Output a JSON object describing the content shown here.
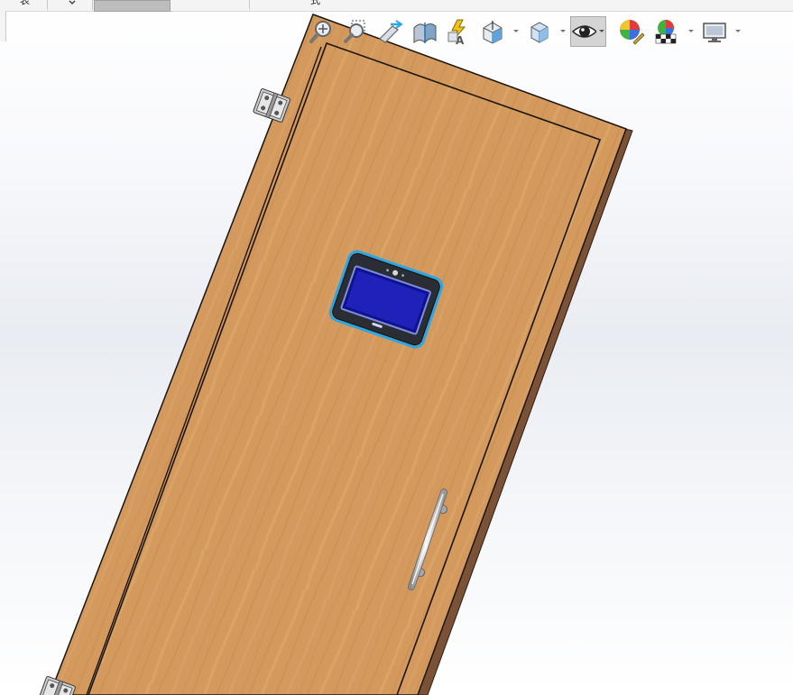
{
  "window": {
    "tabs": [
      {
        "label": "表",
        "selected": false
      },
      {
        "label": "",
        "selected": false
      },
      {
        "label": "",
        "selected": true
      },
      {
        "label": "",
        "selected": false
      },
      {
        "label": "式",
        "selected": false
      }
    ]
  },
  "toolbar": {
    "items": [
      {
        "name": "zoom-to-fit-icon"
      },
      {
        "name": "zoom-to-area-icon"
      },
      {
        "name": "previous-view-icon"
      },
      {
        "name": "section-view-icon"
      },
      {
        "name": "dynamic-annotation-views-icon"
      },
      {
        "name": "view-orientation-icon"
      },
      {
        "name": "display-style-icon"
      },
      {
        "name": "hide-show-items-icon",
        "active": true
      },
      {
        "name": "edit-appearance-icon"
      },
      {
        "name": "apply-scene-icon"
      },
      {
        "name": "view-settings-icon"
      }
    ]
  },
  "model": {
    "description_colors": {
      "wood": "#d59a5e",
      "frame_edge": "#1a1410",
      "screen_blue": "#1f22b8",
      "screen_bezel": "#2a2d33",
      "selection_highlight": "#2aa6e6"
    }
  }
}
